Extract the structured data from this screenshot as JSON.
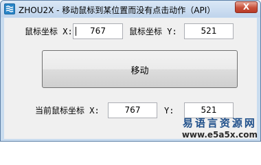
{
  "window": {
    "title": "ZHOU2X - 移动鼠标到某位置而没有点击动作（API）",
    "close_label": "X"
  },
  "target": {
    "x_label": "鼠标坐标 X:",
    "x_value": "767",
    "y_label": "鼠标坐标 Y:",
    "y_value": "521"
  },
  "move_button": {
    "label": "移动"
  },
  "current": {
    "x_label": "当前鼠标坐标 X:",
    "x_value": "767",
    "y_label": "Y:",
    "y_value": "521"
  },
  "watermark": {
    "name": "易语言资源网",
    "url": "www.e5a5x.com"
  },
  "colors": {
    "title_bar": "#c9dcef",
    "client_bg": "#f0f0f0",
    "close_button": "#c8503a",
    "watermark_text": "#1f4f8a"
  }
}
